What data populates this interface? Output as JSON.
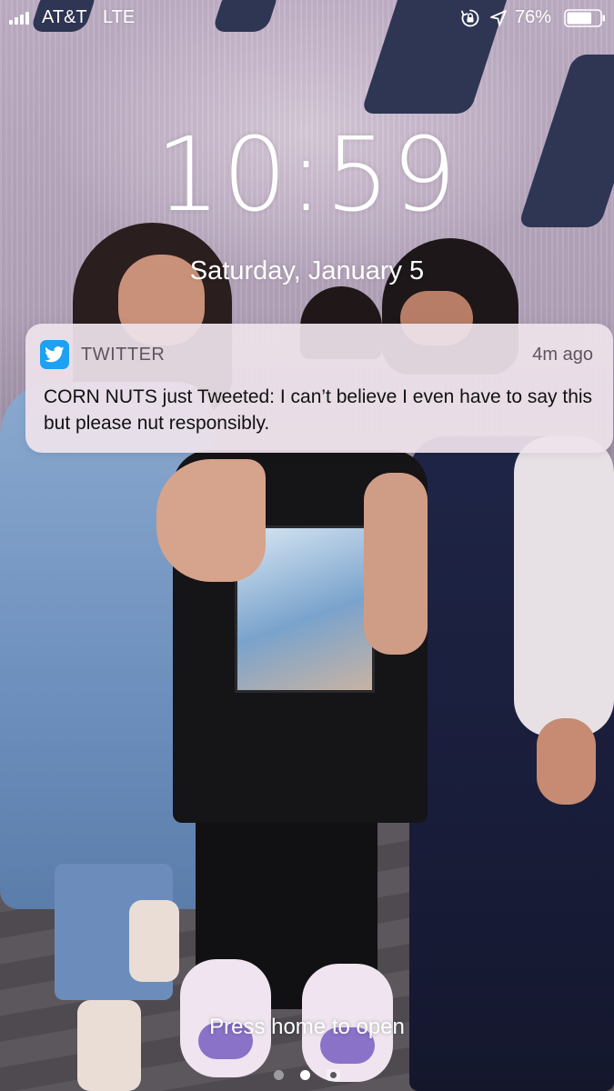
{
  "status_bar": {
    "carrier": "AT&T",
    "network": "LTE",
    "battery_percent": "76%",
    "battery_level": 0.76,
    "icons": [
      "signal-icon",
      "rotation-lock-icon",
      "location-arrow-icon",
      "battery-icon"
    ]
  },
  "lock_screen": {
    "time": "10:59",
    "date": "Saturday, January 5"
  },
  "notification": {
    "app_name": "TWITTER",
    "app_icon": "twitter-bird-icon",
    "app_color": "#1da1f2",
    "time_ago": "4m ago",
    "body": "CORN NUTS just Tweeted: I can’t believe I even have to say this but please nut responsibly."
  },
  "bottom": {
    "hint": "Press home to open",
    "page_dots": [
      "today-view",
      "lock-screen",
      "camera"
    ],
    "active_page": 1
  }
}
